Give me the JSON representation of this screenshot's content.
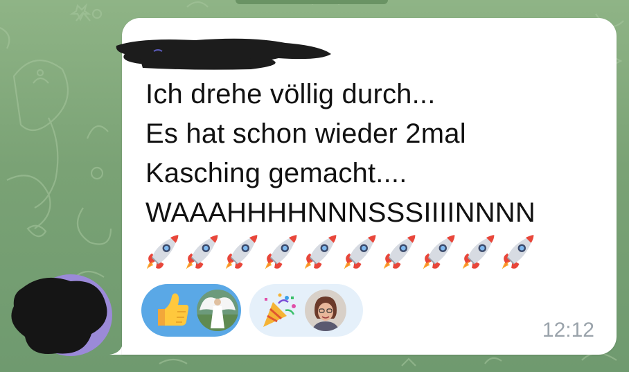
{
  "chat": {
    "sender_name": "",
    "message_lines": [
      "Ich drehe völlig durch...",
      "Es hat schon wieder 2mal",
      "Kasching gemacht....",
      "WAAAHHHHNNNSSSIIIINNNN"
    ],
    "rocket_count": 10,
    "rocket_icon": "rocket-emoji",
    "time": "12:12"
  },
  "reactions": [
    {
      "emoji_icon": "thumbs-up-emoji",
      "reacted_by_me": true,
      "reactor_avatar": "angel-avatar"
    },
    {
      "emoji_icon": "party-popper-emoji",
      "reacted_by_me": false,
      "reactor_avatar": "woman-avatar"
    }
  ],
  "colors": {
    "wallpaper": "#7fa777",
    "bubble": "#ffffff",
    "text": "#111111",
    "reaction_active": "#5aa8e6",
    "reaction_inactive": "#e5f0fa",
    "timestamp": "#9aa3ab",
    "avatar_ring": "#9b8ad8"
  }
}
